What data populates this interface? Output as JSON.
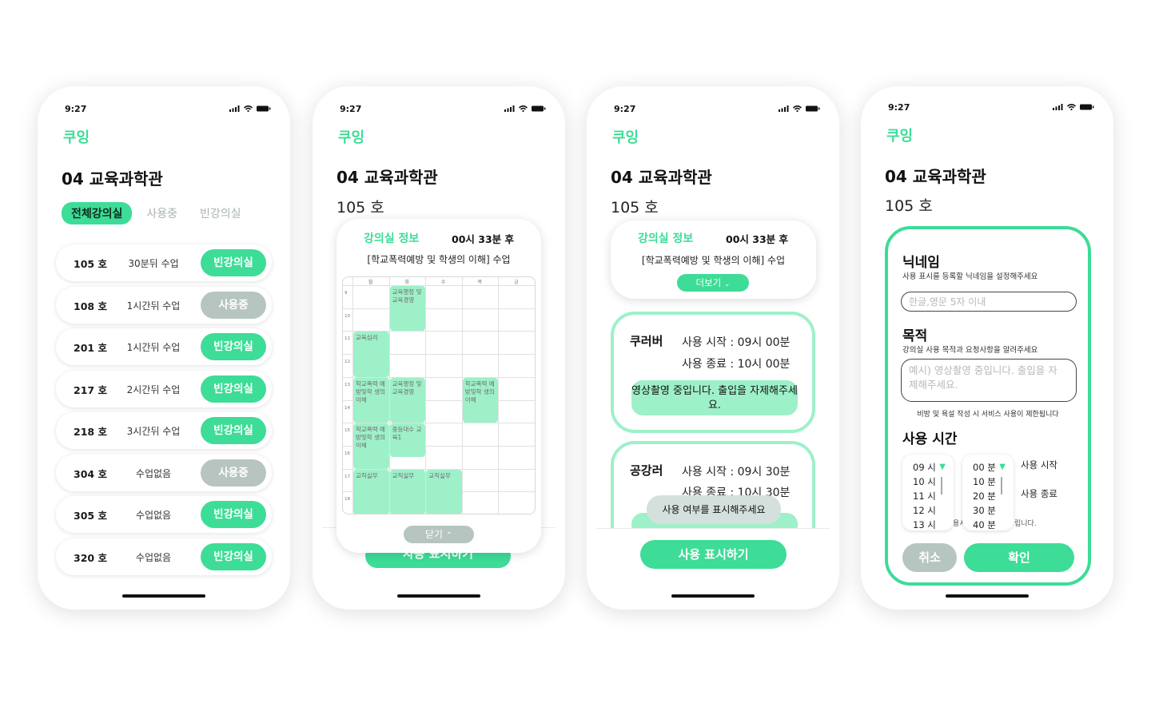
{
  "app": {
    "brand": "쿠잉",
    "time": "9:27",
    "building": "04 교육과학관",
    "room": "105 호"
  },
  "colors": {
    "accent": "#3ddc97",
    "accent_light": "#9ef0c9",
    "busy": "#b6c5bf"
  },
  "icons": {
    "signal": "signal-icon",
    "wifi": "wifi-icon",
    "battery": "battery-icon"
  },
  "screen1": {
    "tabs": [
      "전체강의실",
      "사용중",
      "빈강의실"
    ],
    "rooms": [
      {
        "room": "105 호",
        "next": "30분뒤 수업",
        "status": "빈강의실",
        "free": true
      },
      {
        "room": "108 호",
        "next": "1시간뒤 수업",
        "status": "사용중",
        "free": false
      },
      {
        "room": "201 호",
        "next": "1시간뒤 수업",
        "status": "빈강의실",
        "free": true
      },
      {
        "room": "217 호",
        "next": "2시간뒤 수업",
        "status": "빈강의실",
        "free": true
      },
      {
        "room": "218 호",
        "next": "3시간뒤 수업",
        "status": "빈강의실",
        "free": true
      },
      {
        "room": "304 호",
        "next": "수업없음",
        "status": "사용중",
        "free": false
      },
      {
        "room": "305 호",
        "next": "수업없음",
        "status": "빈강의실",
        "free": true
      },
      {
        "room": "320 호",
        "next": "수업없음",
        "status": "빈강의실",
        "free": true
      }
    ]
  },
  "screen2": {
    "info_label": "강의실 정보",
    "timer": "00시 33분 후",
    "current_class": "[학교폭력예방 및 학생의 이해] 수업",
    "days": [
      "월",
      "화",
      "수",
      "목",
      "금"
    ],
    "hours": [
      "9",
      "10",
      "11",
      "12",
      "13",
      "14",
      "15",
      "16",
      "17",
      "18"
    ],
    "blocks": [
      {
        "text": "교육행정 및 교육경영",
        "day": 1,
        "start": 0,
        "end": 2
      },
      {
        "text": "교육심리",
        "day": 0,
        "start": 2,
        "end": 4
      },
      {
        "text": "학교폭력 예방및학 생의이해",
        "day": 0,
        "start": 4,
        "end": 6
      },
      {
        "text": "교육행정 및 교육경영",
        "day": 1,
        "start": 4,
        "end": 6
      },
      {
        "text": "학교폭력 예방및학 생의이해",
        "day": 3,
        "start": 4,
        "end": 6
      },
      {
        "text": "학교폭력 예방및학 생의이해",
        "day": 0,
        "start": 6,
        "end": 8
      },
      {
        "text": "중등대수 교육1",
        "day": 1,
        "start": 6,
        "end": 7.5
      },
      {
        "text": "교직실무",
        "day": 0,
        "start": 8,
        "end": 10
      },
      {
        "text": "교직실무",
        "day": 1,
        "start": 8,
        "end": 10
      },
      {
        "text": "교직실무",
        "day": 2,
        "start": 8,
        "end": 10
      }
    ],
    "close_label": "닫기",
    "bg_button": "사용 표시하기"
  },
  "screen3": {
    "info_label": "강의실 정보",
    "timer": "00시 33분 후",
    "current_class": "[학교폭력예방 및 학생의 이해] 수업",
    "more_label": "더보기",
    "usages": [
      {
        "name": "쿠러버",
        "start": "사용 시작 :  09시 00분",
        "end": "사용 종료 :  10시 00분",
        "message": "영상촬영 중입니다. 출입을 자제해주세요."
      },
      {
        "name": "공강러",
        "start": "사용 시작 :  09시 30분",
        "end": "사용 종료 :  10시 30분"
      }
    ],
    "toast": "사용 여부를 표시해주세요",
    "button": "사용 표시하기"
  },
  "screen4": {
    "nickname_title": "닉네임",
    "nickname_sub": "사용 표시를 등록할 닉네임을 설정해주세요",
    "nickname_placeholder": "한글,영문 5자 이내",
    "purpose_title": "목적",
    "purpose_sub": "강의실 사용 목적과 요청사항을 알려주세요",
    "purpose_placeholder": "예시) 영상촬영 중입니다. 출입을 자제해주세요.",
    "warning": "비방 및 욕설 작성 시 서비스 사용이 제한됩니다",
    "time_title": "사용 시간",
    "hours": [
      "09 시",
      "10 시",
      "11 시",
      "12 시",
      "13 시"
    ],
    "minutes": [
      "00 분",
      "10 분",
      "20 분",
      "30 분",
      "40 분"
    ],
    "start_label": "사용 시작",
    "end_label": "사용 종료",
    "peek_left": "용시",
    "peek_right": "립니다.",
    "cancel": "취소",
    "confirm": "확인"
  }
}
